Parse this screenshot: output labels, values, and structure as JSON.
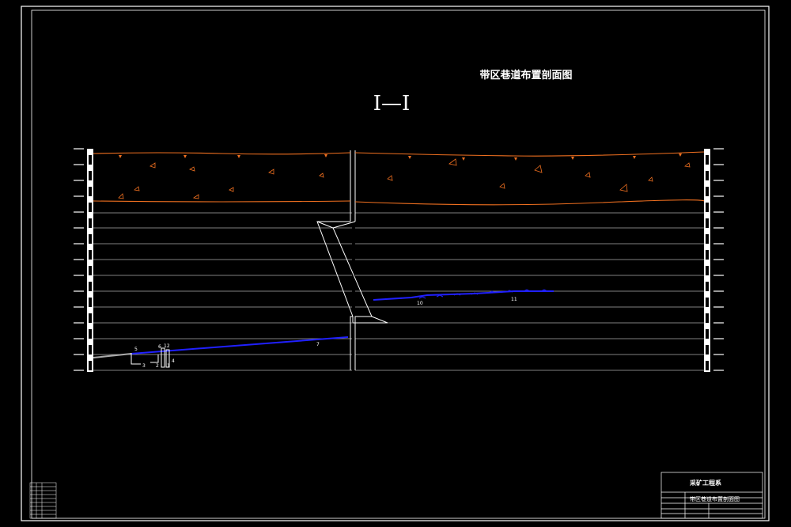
{
  "drawing": {
    "title": "带区巷道布置剖面图",
    "section_label": "I—I"
  },
  "title_block": {
    "company": "采矿工程系",
    "drawing_name": "带区巷道布置剖面图"
  },
  "roadway_labels": [
    "1",
    "2",
    "3",
    "4",
    "5",
    "6",
    "7",
    "10",
    "11",
    "12"
  ],
  "colors": {
    "frame": "#ffffff",
    "topsoil": "#f07020",
    "roadway": "#2020ff",
    "background": "#000000"
  }
}
